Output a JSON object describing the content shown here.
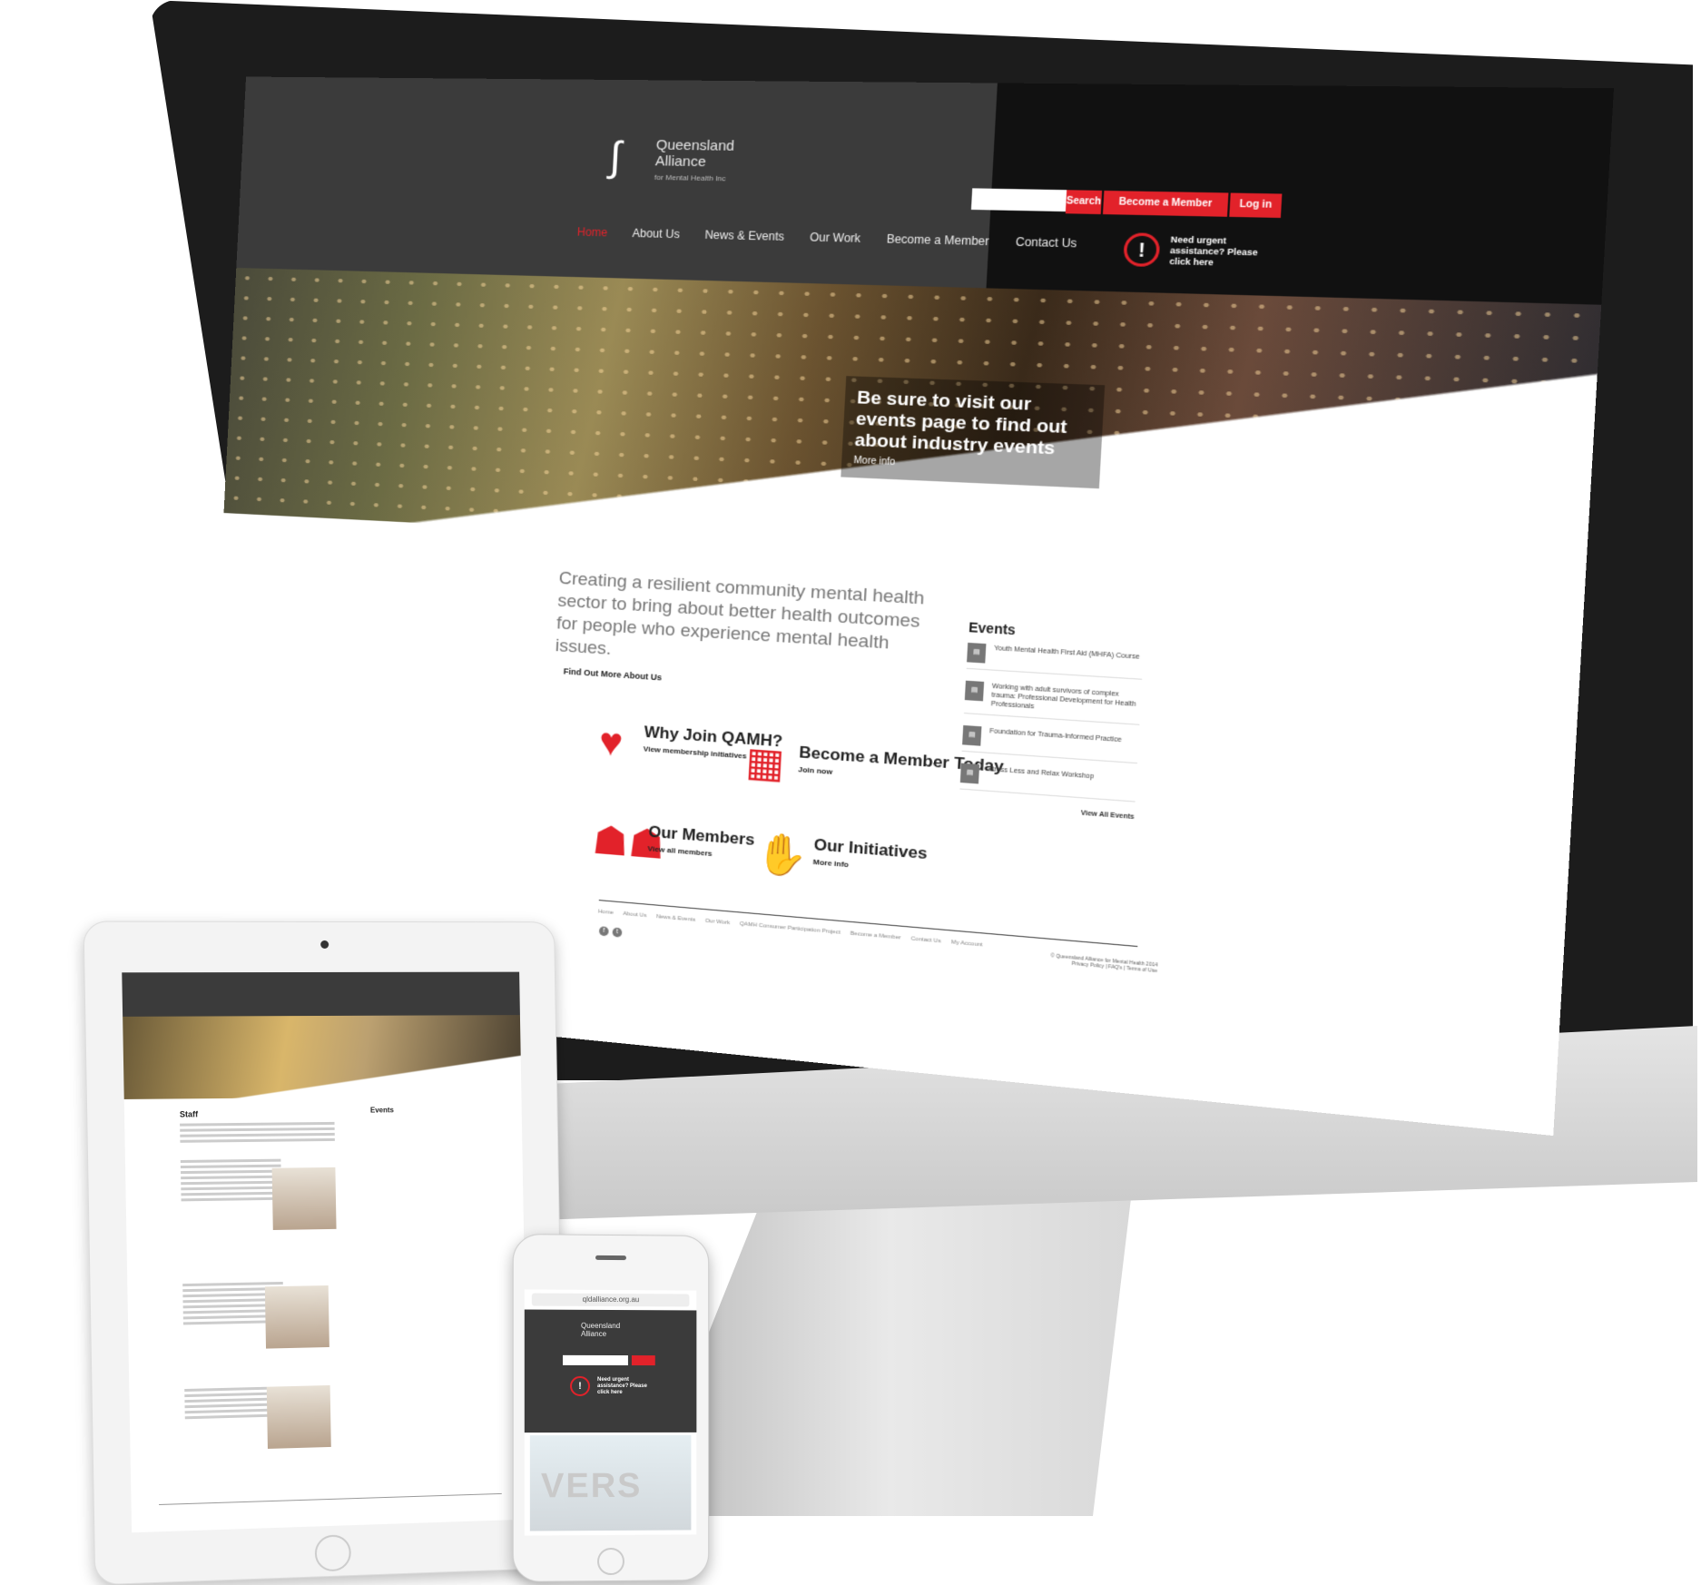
{
  "desktop": {
    "logo": {
      "line1": "Queensland",
      "line2": "Alliance",
      "sub": "for Mental Health Inc"
    },
    "search": {
      "placeholder": "",
      "button": "Search"
    },
    "header_buttons": {
      "become_member": "Become a Member",
      "login": "Log in"
    },
    "nav": [
      "Home",
      "About Us",
      "News & Events",
      "Our Work",
      "Become a Member",
      "Contact Us"
    ],
    "urgent": {
      "icon": "!",
      "text": "Need urgent assistance? Please click here"
    },
    "hero": {
      "headline": "Be sure to visit our events page to find out about industry events",
      "link": "More info"
    },
    "intro": {
      "text": "Creating a resilient community mental health sector to bring about better health outcomes for people who experience mental health issues.",
      "link": "Find Out More About Us"
    },
    "features": [
      {
        "title": "Why Join QAMH?",
        "link": "View membership initiatives",
        "icon": "heart-icon"
      },
      {
        "title": "Become a Member Today",
        "link": "Join now",
        "icon": "calendar-icon"
      },
      {
        "title": "Our Members",
        "link": "View all members",
        "icon": "people-icon"
      },
      {
        "title": "Our Initiatives",
        "link": "More info",
        "icon": "hand-icon"
      }
    ],
    "events": {
      "title": "Events",
      "items": [
        "Youth Mental Health First Aid (MHFA) Course",
        "Working with adult survivors of complex trauma: Professional Development for Health Professionals",
        "Foundation for Trauma-Informed Practice",
        "Stress Less and Relax Workshop"
      ],
      "view_all": "View All Events"
    },
    "footer": {
      "links": [
        "Home",
        "About Us",
        "News & Events",
        "Our Work",
        "QAMH Consumer Participation Project",
        "Become a Member",
        "Contact Us",
        "My Account"
      ],
      "copyright": "© Queensland Alliance for Mental Health 2014",
      "legal": "Privacy Policy | FAQ's | Terms of Use"
    }
  },
  "tablet": {
    "page_title": "Staff",
    "events_title": "Events"
  },
  "mobile": {
    "url": "qldalliance.org.au",
    "alert_icon": "!",
    "alert_text": "Need urgent assistance? Please click here",
    "hero_word": "VERS"
  },
  "colors": {
    "accent": "#e2222a",
    "header": "#3b3b3b"
  }
}
